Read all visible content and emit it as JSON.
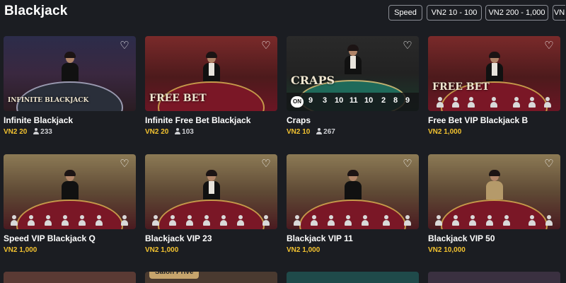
{
  "header": {
    "title": "Blackjack",
    "filters": [
      "Speed",
      "VN2 10 - 100",
      "VN2 200 - 1,000",
      "VN"
    ]
  },
  "cards": [
    {
      "title": "Infinite Blackjack",
      "bet": "VN2 20",
      "players": "233",
      "logo": "INFINITE BLACKJACK"
    },
    {
      "title": "Infinite Free Bet Blackjack",
      "bet": "VN2 20",
      "players": "103",
      "logo": "FREE BET"
    },
    {
      "title": "Craps",
      "bet": "VN2 10",
      "players": "267",
      "logo": "CRAPS",
      "dice": [
        "ON",
        "9",
        "3",
        "10",
        "11",
        "10",
        "2",
        "8",
        "9"
      ]
    },
    {
      "title": "Free Bet VIP Blackjack B",
      "bet": "VN2 1,000",
      "players": "",
      "logo": "FREE BET"
    },
    {
      "title": "Speed VIP Blackjack Q",
      "bet": "VN2 1,000",
      "players": ""
    },
    {
      "title": "Blackjack VIP 23",
      "bet": "VN2 1,000",
      "players": ""
    },
    {
      "title": "Blackjack VIP 11",
      "bet": "VN2 1,000",
      "players": ""
    },
    {
      "title": "Blackjack VIP 50",
      "bet": "VN2 10,000",
      "players": ""
    }
  ],
  "partial_row": {
    "badge": "Salon Privé"
  },
  "icons": {
    "favorite": "heart-outline-icon",
    "players": "person-icon",
    "seat": "empty-seat-icon"
  },
  "colors": {
    "background": "#1b1d22",
    "bet_amount": "#f2c230",
    "badge": "#c6a46c"
  }
}
